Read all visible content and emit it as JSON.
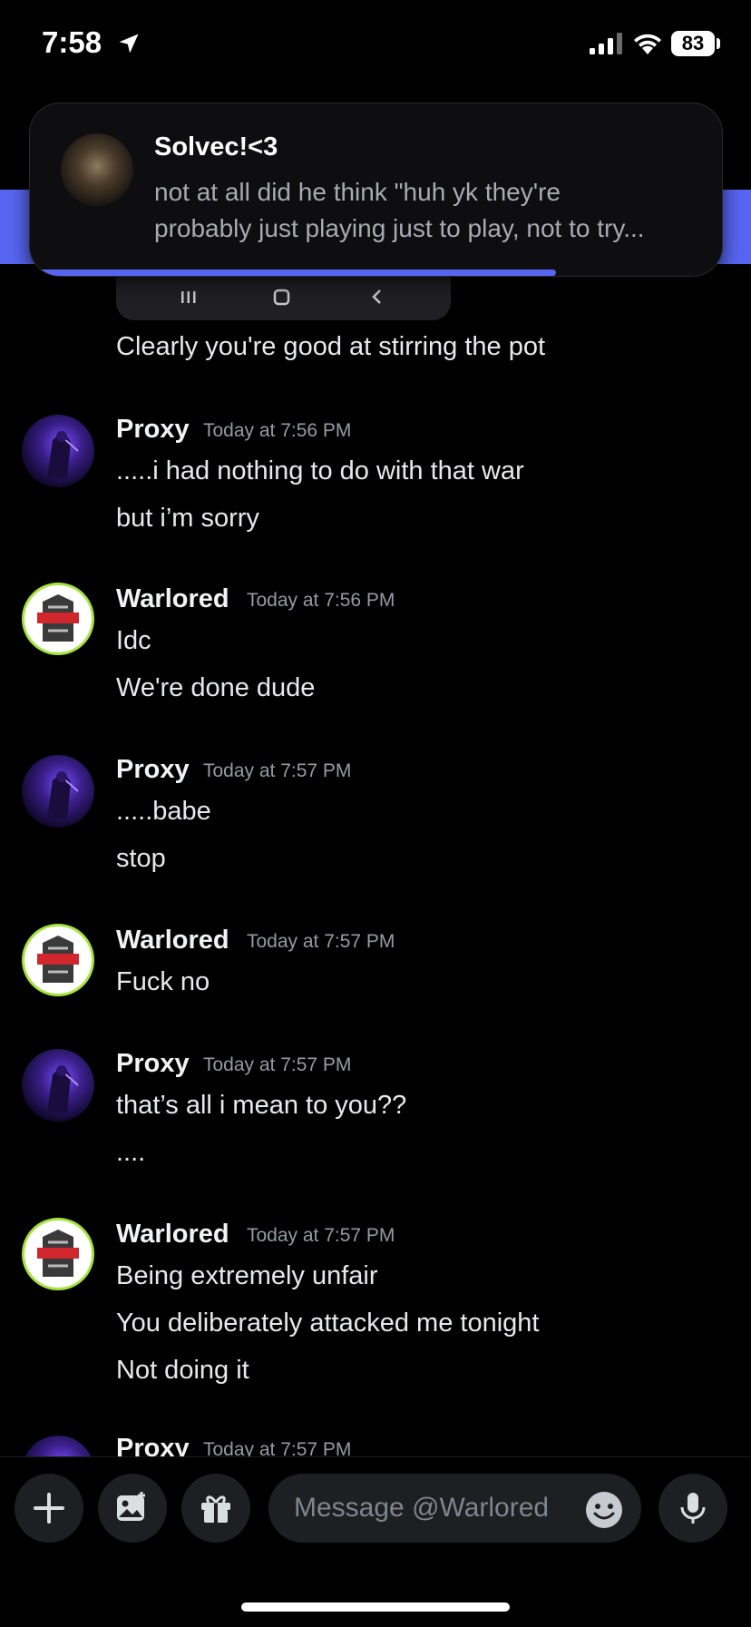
{
  "status_bar": {
    "time": "7:58",
    "battery": "83"
  },
  "notification": {
    "title": "Solvec!<3",
    "body_line1": "not at all did he think \"huh yk they're",
    "body_line2": "probably just playing just to play, not to try..."
  },
  "previous_message": {
    "text": "Clearly you're good at stirring the pot"
  },
  "messages": [
    {
      "author": "Proxy",
      "timestamp": "Today at 7:56 PM",
      "lines": [
        ".....i had nothing to do with that war",
        "but i’m sorry"
      ]
    },
    {
      "author": "Warlored",
      "timestamp": "Today at 7:56 PM",
      "lines": [
        "Idc",
        "We're done dude"
      ]
    },
    {
      "author": "Proxy",
      "timestamp": "Today at 7:57 PM",
      "lines": [
        ".....babe",
        "stop"
      ]
    },
    {
      "author": "Warlored",
      "timestamp": "Today at 7:57 PM",
      "lines": [
        "Fuck no"
      ]
    },
    {
      "author": "Proxy",
      "timestamp": "Today at 7:57 PM",
      "lines": [
        "that’s all i mean to you??",
        "...."
      ]
    },
    {
      "author": "Warlored",
      "timestamp": "Today at 7:57 PM",
      "lines": [
        "Being extremely unfair",
        "You deliberately attacked me tonight",
        "Not doing it"
      ]
    },
    {
      "author": "Proxy",
      "timestamp": "Today at 7:57 PM",
      "lines": []
    }
  ],
  "composer": {
    "placeholder": "Message @Warlored"
  },
  "colors": {
    "accent": "#5865f2",
    "background": "#000000",
    "status_ring": "#a6e33c"
  }
}
